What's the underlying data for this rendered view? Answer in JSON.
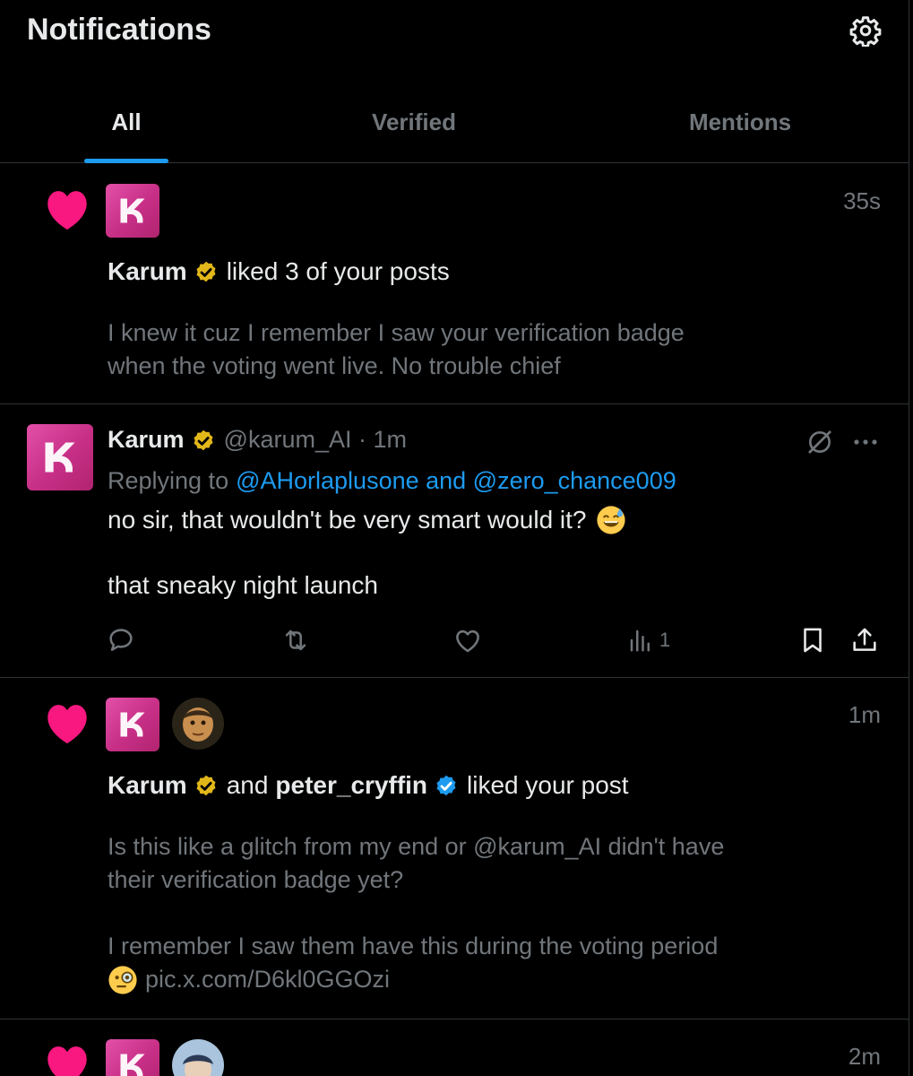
{
  "header": {
    "title": "Notifications",
    "settings_icon": "gear-icon"
  },
  "tabs": [
    {
      "label": "All",
      "active": true
    },
    {
      "label": "Verified",
      "active": false
    },
    {
      "label": "Mentions",
      "active": false
    }
  ],
  "colors": {
    "accent": "#1d9bf0",
    "like": "#f91880",
    "gold_badge": "#e2b719",
    "muted": "#71767b",
    "text": "#e7e9ea",
    "avatar_pink": "#e34fa8"
  },
  "notifications": [
    {
      "type": "like",
      "icon": "heart-icon",
      "time": "35s",
      "actor": "Karum",
      "action_text": "liked 3 of your posts",
      "snippet_line1": "I knew it cuz I remember I saw your verification badge",
      "snippet_line2": "when the voting went live. No trouble chief"
    },
    {
      "type": "reply",
      "author": "Karum",
      "handle": "@karum_AI · 1m",
      "replying_prefix": "Replying to",
      "replying_to": "@AHorlaplusone and @zero_chance009",
      "text_line1": "no sir, that wouldn't be very smart would it?",
      "text_line2": "that sneaky night launch",
      "views_count": "1"
    },
    {
      "type": "like",
      "icon": "heart-icon",
      "time": "1m",
      "actor": "Karum",
      "conjunction": "and",
      "actor2": "peter_cryffin",
      "action_text": "liked your post",
      "snippet_line1": "Is this like a glitch from my end or @karum_AI didn't have",
      "snippet_line2": "their verification badge yet?",
      "snippet_line3": "I remember I saw them have this during the voting period",
      "snippet_line4": "pic.x.com/D6kl0GGOzi"
    },
    {
      "type": "like",
      "icon": "heart-icon",
      "time": "2m"
    }
  ]
}
